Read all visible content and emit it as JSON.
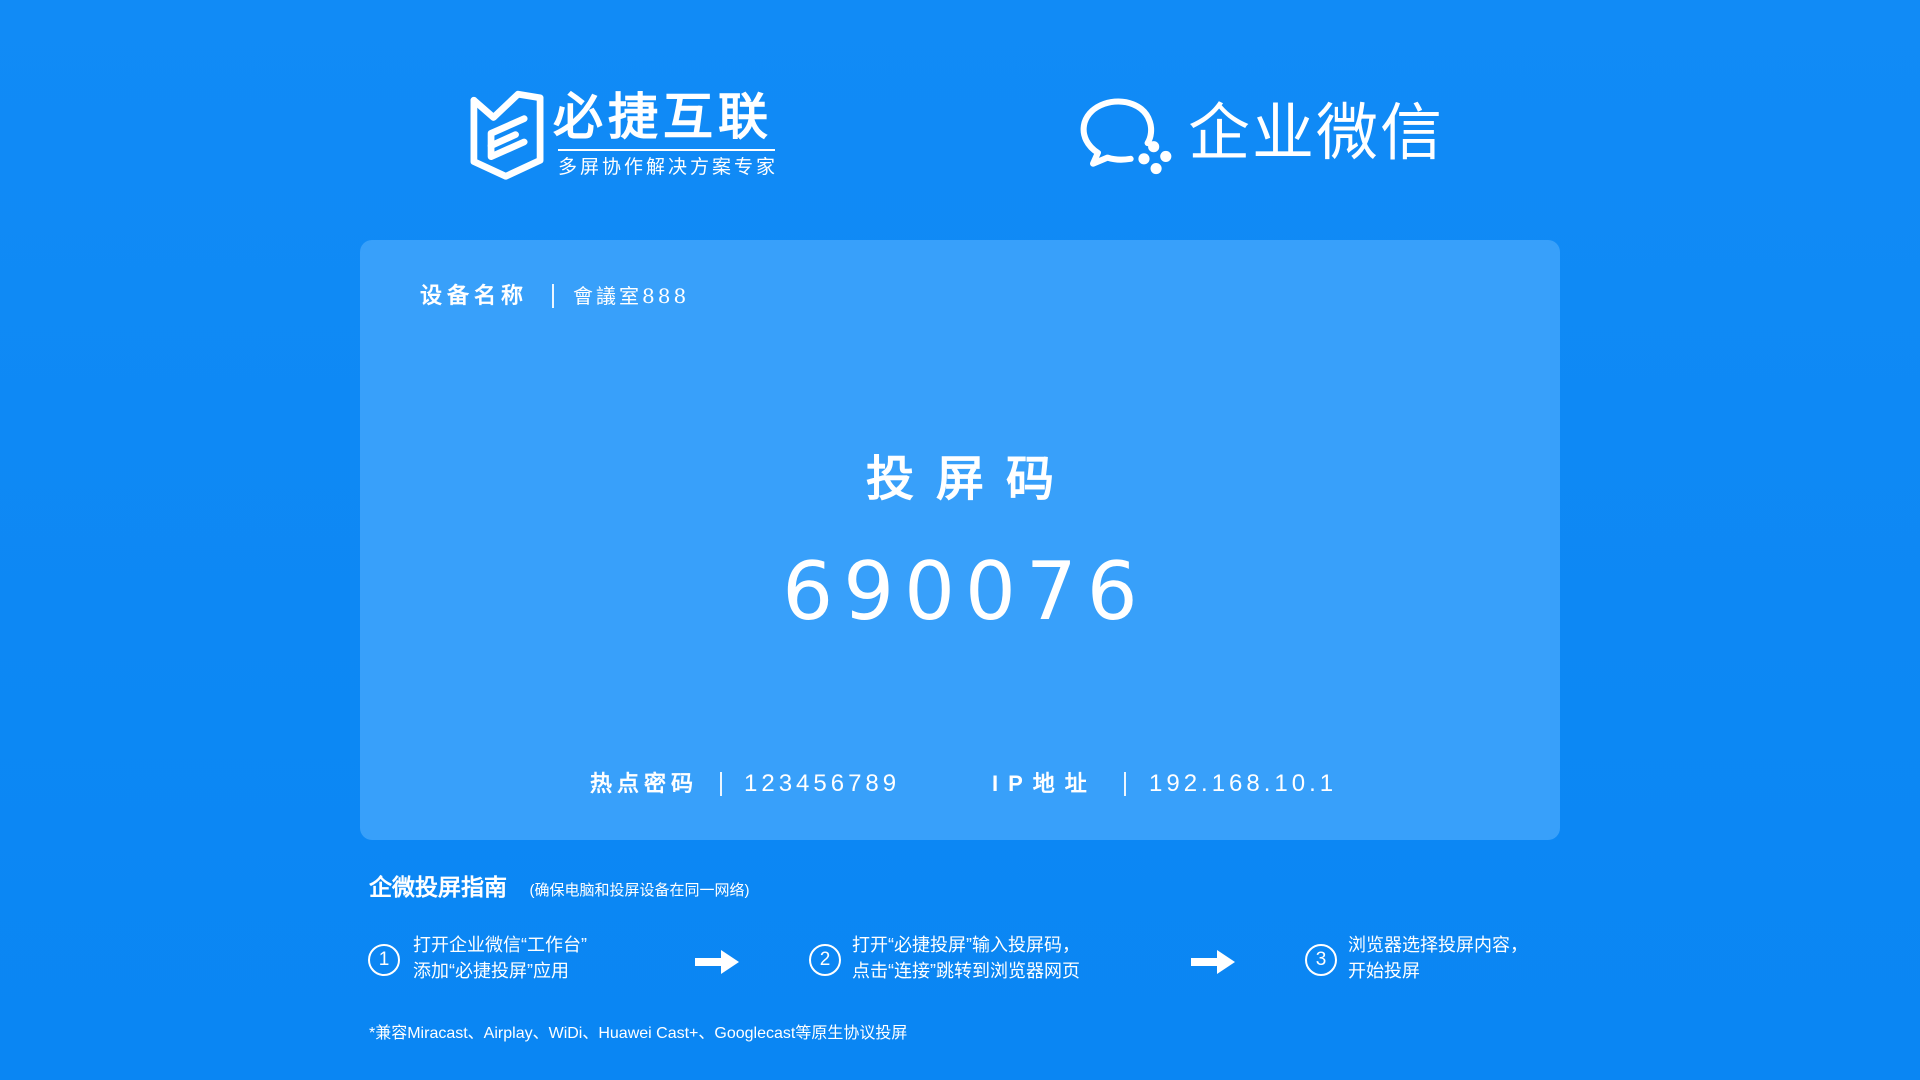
{
  "colors": {
    "background": "#0d89f5",
    "card": "#38a0fa",
    "text": "#ffffff"
  },
  "header": {
    "brand": {
      "icon": "bijie-logo-icon",
      "name": "必捷互联",
      "tagline": "多屏协作解决方案专家"
    },
    "partner": {
      "icon": "wecom-logo-icon",
      "name": "企业微信"
    }
  },
  "card": {
    "device_label": "设备名称",
    "device_name": "會議室888",
    "code_label": "投屏码",
    "code": "690076",
    "hotspot_label": "热点密码",
    "hotspot_password": "123456789",
    "ip_label": "IP地址",
    "ip_address": "192.168.10.1"
  },
  "guide": {
    "title": "企微投屏指南",
    "note": "(确保电脑和投屏设备在同一网络)",
    "arrow_icon": "right-arrow-icon",
    "steps": [
      {
        "number": "1",
        "lines": [
          "打开企业微信“工作台”",
          "添加“必捷投屏”应用"
        ]
      },
      {
        "number": "2",
        "lines": [
          "打开“必捷投屏”输入投屏码，",
          "点击“连接”跳转到浏览器网页"
        ]
      },
      {
        "number": "3",
        "lines": [
          "浏览器选择投屏内容，",
          "开始投屏"
        ]
      }
    ],
    "footnote": "*兼容Miracast、Airplay、WiDi、Huawei Cast+、Googlecast等原生协议投屏"
  }
}
